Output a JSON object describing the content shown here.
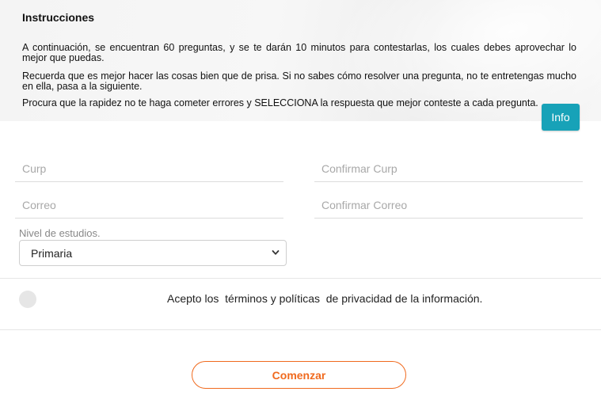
{
  "instructions": {
    "title": "Instrucciones",
    "paragraphs": [
      "A continuación, se encuentran 60 preguntas, y se te darán 10 minutos para contestarlas, los cuales debes aprovechar lo mejor que puedas.",
      "Recuerda que es mejor hacer las cosas bien que de prisa. Si no sabes cómo resolver una pregunta, no te entretengas mucho en ella, pasa a la siguiente.",
      "Procura que la rapidez no te haga cometer errores y SELECCIONA la respuesta que mejor conteste a cada pregunta."
    ],
    "info_button": "Info",
    "info_color": "#17a2b8"
  },
  "form": {
    "curp": {
      "placeholder": "Curp",
      "value": ""
    },
    "confirm_curp": {
      "placeholder": "Confirmar Curp",
      "value": ""
    },
    "correo": {
      "placeholder": "Correo",
      "value": ""
    },
    "confirm_correo": {
      "placeholder": "Confirmar Correo",
      "value": ""
    },
    "nivel": {
      "label": "Nivel de estudios.",
      "selected": "Primaria",
      "icon": "chevron-down-icon"
    }
  },
  "terms": {
    "prefix": "Acepto los  ",
    "link": "términos y políticas",
    "suffix": "  de privacidad de la información.",
    "checked": false
  },
  "start_button": {
    "label": "Comenzar",
    "color": "#f06a1e"
  }
}
